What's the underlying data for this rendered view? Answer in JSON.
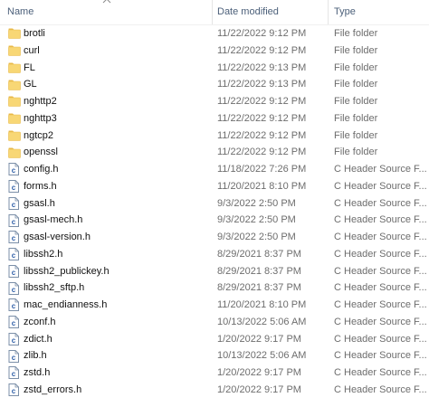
{
  "columns": {
    "name": "Name",
    "date": "Date modified",
    "type": "Type"
  },
  "sort": {
    "column": "name",
    "direction": "ascending",
    "icon": "sort-up-chevron-icon"
  },
  "icons": {
    "folder": "folder-icon",
    "file": "c-header-file-icon"
  },
  "colors": {
    "folder_fill": "#f8d775",
    "folder_tab": "#e8b948",
    "file_outline": "#7b8fa8",
    "file_letter": "#2f5fa8",
    "header_text": "#4c607a",
    "secondary_text": "#6d6d6d"
  },
  "items": [
    {
      "kind": "folder",
      "name": "brotli",
      "date": "11/22/2022 9:12 PM",
      "type": "File folder"
    },
    {
      "kind": "folder",
      "name": "curl",
      "date": "11/22/2022 9:12 PM",
      "type": "File folder"
    },
    {
      "kind": "folder",
      "name": "FL",
      "date": "11/22/2022 9:13 PM",
      "type": "File folder"
    },
    {
      "kind": "folder",
      "name": "GL",
      "date": "11/22/2022 9:13 PM",
      "type": "File folder"
    },
    {
      "kind": "folder",
      "name": "nghttp2",
      "date": "11/22/2022 9:12 PM",
      "type": "File folder"
    },
    {
      "kind": "folder",
      "name": "nghttp3",
      "date": "11/22/2022 9:12 PM",
      "type": "File folder"
    },
    {
      "kind": "folder",
      "name": "ngtcp2",
      "date": "11/22/2022 9:12 PM",
      "type": "File folder"
    },
    {
      "kind": "folder",
      "name": "openssl",
      "date": "11/22/2022 9:12 PM",
      "type": "File folder"
    },
    {
      "kind": "file",
      "name": "config.h",
      "date": "11/18/2022 7:26 PM",
      "type": "C Header Source F..."
    },
    {
      "kind": "file",
      "name": "forms.h",
      "date": "11/20/2021 8:10 PM",
      "type": "C Header Source F..."
    },
    {
      "kind": "file",
      "name": "gsasl.h",
      "date": "9/3/2022 2:50 PM",
      "type": "C Header Source F..."
    },
    {
      "kind": "file",
      "name": "gsasl-mech.h",
      "date": "9/3/2022 2:50 PM",
      "type": "C Header Source F..."
    },
    {
      "kind": "file",
      "name": "gsasl-version.h",
      "date": "9/3/2022 2:50 PM",
      "type": "C Header Source F..."
    },
    {
      "kind": "file",
      "name": "libssh2.h",
      "date": "8/29/2021 8:37 PM",
      "type": "C Header Source F..."
    },
    {
      "kind": "file",
      "name": "libssh2_publickey.h",
      "date": "8/29/2021 8:37 PM",
      "type": "C Header Source F..."
    },
    {
      "kind": "file",
      "name": "libssh2_sftp.h",
      "date": "8/29/2021 8:37 PM",
      "type": "C Header Source F..."
    },
    {
      "kind": "file",
      "name": "mac_endianness.h",
      "date": "11/20/2021 8:10 PM",
      "type": "C Header Source F..."
    },
    {
      "kind": "file",
      "name": "zconf.h",
      "date": "10/13/2022 5:06 AM",
      "type": "C Header Source F..."
    },
    {
      "kind": "file",
      "name": "zdict.h",
      "date": "1/20/2022 9:17 PM",
      "type": "C Header Source F..."
    },
    {
      "kind": "file",
      "name": "zlib.h",
      "date": "10/13/2022 5:06 AM",
      "type": "C Header Source F..."
    },
    {
      "kind": "file",
      "name": "zstd.h",
      "date": "1/20/2022 9:17 PM",
      "type": "C Header Source F..."
    },
    {
      "kind": "file",
      "name": "zstd_errors.h",
      "date": "1/20/2022 9:17 PM",
      "type": "C Header Source F..."
    }
  ]
}
